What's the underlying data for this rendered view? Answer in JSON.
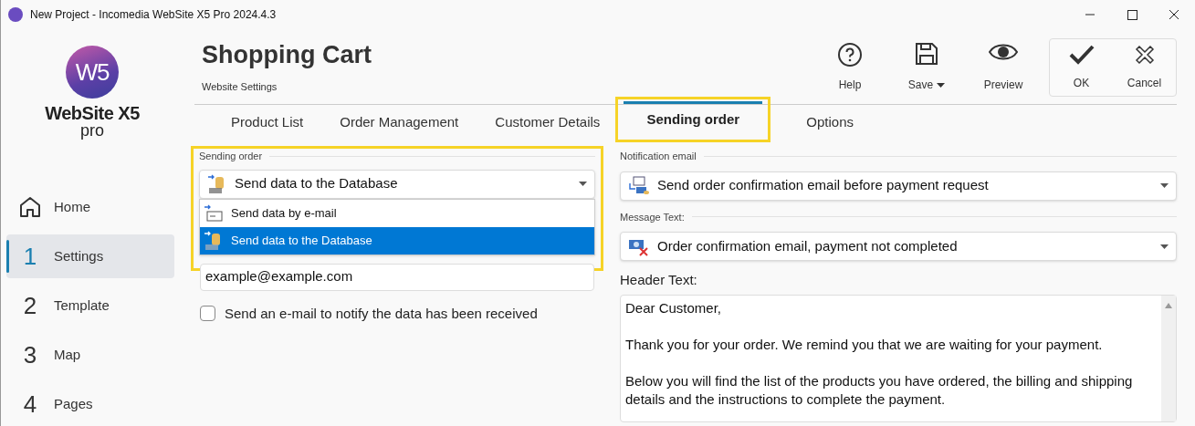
{
  "window": {
    "title": "New Project - Incomedia WebSite X5 Pro 2024.4.3"
  },
  "logo": {
    "mark": "W5",
    "name": "WebSite X5",
    "edition": "pro"
  },
  "header": {
    "title": "Shopping Cart",
    "subtitle": "Website Settings"
  },
  "toolbar": [
    {
      "kind": "help",
      "label": "Help",
      "has_menu": false
    },
    {
      "kind": "save",
      "label": "Save",
      "has_menu": true
    },
    {
      "kind": "preview",
      "label": "Preview",
      "has_menu": false
    }
  ],
  "dialog_buttons": [
    {
      "kind": "ok",
      "label": "OK"
    },
    {
      "kind": "cancel",
      "label": "Cancel"
    }
  ],
  "tabs": [
    {
      "label": "Product List",
      "selected": false,
      "highlighted": false
    },
    {
      "label": "Order Management",
      "selected": false,
      "highlighted": false
    },
    {
      "label": "Customer Details",
      "selected": false,
      "highlighted": false
    },
    {
      "label": "Sending order",
      "selected": true,
      "highlighted": true
    },
    {
      "label": "Options",
      "selected": false,
      "highlighted": false
    }
  ],
  "sidebar": {
    "items": [
      {
        "kind": "home",
        "label": "Home",
        "selected": false
      },
      {
        "kind": "step",
        "number": "1",
        "label": "Settings",
        "selected": true
      },
      {
        "kind": "step",
        "number": "2",
        "label": "Template",
        "selected": false
      },
      {
        "kind": "step",
        "number": "3",
        "label": "Map",
        "selected": false
      },
      {
        "kind": "step",
        "number": "4",
        "label": "Pages",
        "selected": false
      }
    ]
  },
  "sending_order": {
    "label": "Sending order",
    "highlighted": true,
    "dropdown": {
      "value": "Send data to the Database",
      "kind": "database",
      "open": true,
      "options": [
        {
          "kind": "email",
          "label": "Send data by e-mail",
          "selected": false
        },
        {
          "kind": "database",
          "label": "Send data to the Database",
          "selected": true
        }
      ]
    },
    "email_field": {
      "value": "example@example.com"
    },
    "notify_checkbox": {
      "label": "Send an e-mail to notify the data has been received",
      "checked": false
    }
  },
  "notification_email": {
    "label": "Notification email",
    "dropdown": {
      "kind": "confirm",
      "value": "Send order confirmation email before payment request"
    }
  },
  "message_text": {
    "label": "Message Text:",
    "dropdown": {
      "kind": "unpaid",
      "value": "Order confirmation email, payment not completed"
    }
  },
  "header_text": {
    "label": "Header Text:",
    "paragraphs": [
      "Dear Customer,",
      "Thank you for your order. We remind you that we are waiting for your payment.",
      "Below you will find the list of the products you have ordered, the billing and shipping details and the instructions to complete the payment."
    ]
  }
}
